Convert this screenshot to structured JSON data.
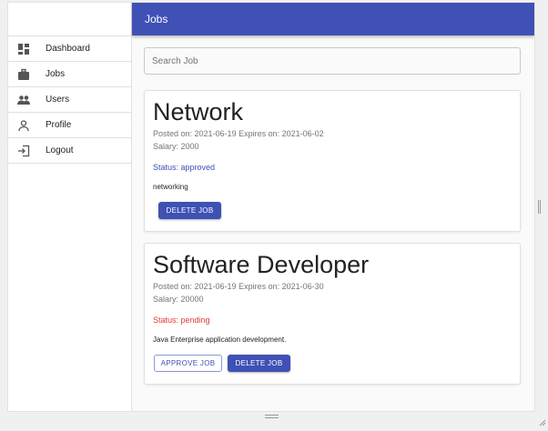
{
  "appbar": {
    "title": "Jobs"
  },
  "sidebar": {
    "items": [
      {
        "label": "Dashboard",
        "icon": "dashboard-icon"
      },
      {
        "label": "Jobs",
        "icon": "briefcase-icon"
      },
      {
        "label": "Users",
        "icon": "users-icon"
      },
      {
        "label": "Profile",
        "icon": "person-icon"
      },
      {
        "label": "Logout",
        "icon": "logout-icon"
      }
    ]
  },
  "search": {
    "placeholder": "Search Job",
    "value": ""
  },
  "jobs": [
    {
      "title": "Network",
      "dates": "Posted on: 2021-06-19  Expires on: 2021-06-02",
      "salary": "Salary: 2000",
      "status": "Status: approved",
      "description": "networking",
      "delete_label": "DELETE JOB"
    },
    {
      "title": "Software Developer",
      "dates": "Posted on: 2021-06-19  Expires on: 2021-06-30",
      "salary": "Salary: 20000",
      "status": "Status: pending",
      "description": "Java Enterprise application development.",
      "approve_label": "APPROVE JOB",
      "delete_label": "DELETE JOB"
    }
  ],
  "colors": {
    "primary": "#3f51b5",
    "approved": "#3f51b5",
    "pending": "#e53935"
  }
}
